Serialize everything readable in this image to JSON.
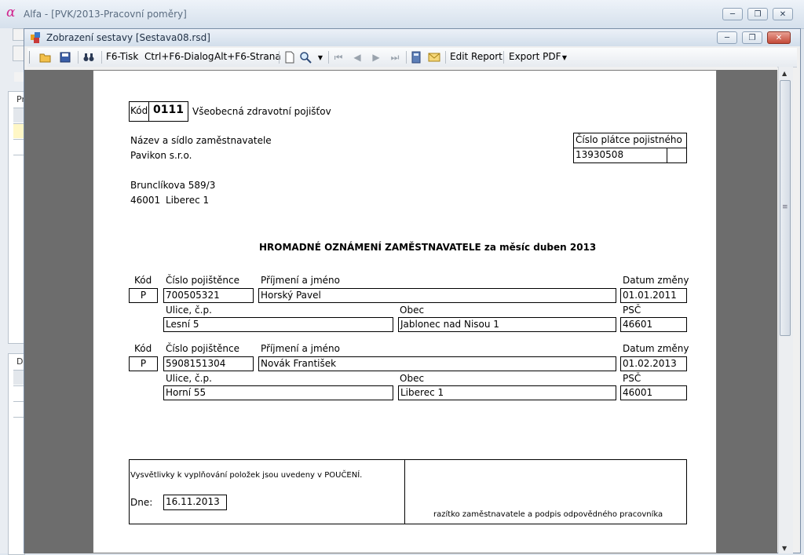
{
  "outer_window": {
    "title": "Alfa - [PVK/2013-Pracovní poměry]",
    "minimize": "─",
    "restore": "❐",
    "close": "✕"
  },
  "left_panel": {
    "label_1": "Pr",
    "label_2": "De"
  },
  "inner_window": {
    "title": "Zobrazení sestavy [Sestava08.rsd]",
    "minimize": "─",
    "restore": "❐",
    "close": "✕"
  },
  "toolbar": {
    "print_label": "F6-Tisk",
    "dialog_label": "Ctrl+F6-Dialog",
    "page_label": "Alt+F6-Strana",
    "edit_report_label": "Edit Report",
    "export_pdf_label": "Export PDF"
  },
  "report": {
    "kod_label": "Kód",
    "kod_value": "0111",
    "insurer_name": "Všeobecná zdravotní pojišťov",
    "employer_label": "Název a sídlo zaměstnavatele",
    "employer_name": "Pavikon s.r.o.",
    "street": "Brunclíkova 589/3",
    "zip": "46001",
    "city": "Liberec 1",
    "payer_label": "Číslo plátce pojistného",
    "payer_number": "13930508",
    "heading": "HROMADNÉ OZNÁMENÍ ZAMĚSTNAVATELE za měsíc duben 2013",
    "col_kod": "Kód",
    "col_insured_no": "Číslo pojištěnce",
    "col_name": "Příjmení a jméno",
    "col_change_date": "Datum změny",
    "col_street": "Ulice, č.p.",
    "col_town": "Obec",
    "col_psc": "PSČ",
    "entries": [
      {
        "kod": "P",
        "insured_no": "700505321",
        "name": "Horský Pavel",
        "change_date": "01.01.2011",
        "street": "Lesní 5",
        "town": "Jablonec nad Nisou 1",
        "psc": "46601"
      },
      {
        "kod": "P",
        "insured_no": "5908151304",
        "name": "Novák František",
        "change_date": "01.02.2013",
        "street": "Horní 55",
        "town": "Liberec 1",
        "psc": "46001"
      }
    ],
    "note": "Vysvětlivky k vyplňování položek jsou uvedeny v POUČENÍ.",
    "date_label": "Dne:",
    "date_value": "16.11.2013",
    "signature_label": "razítko zaměstnavatele a podpis odpovědného pracovníka"
  },
  "colors": {
    "accent": "#d0208c",
    "page_gray": "#6d6d6d",
    "close_red": "#c44a38"
  }
}
